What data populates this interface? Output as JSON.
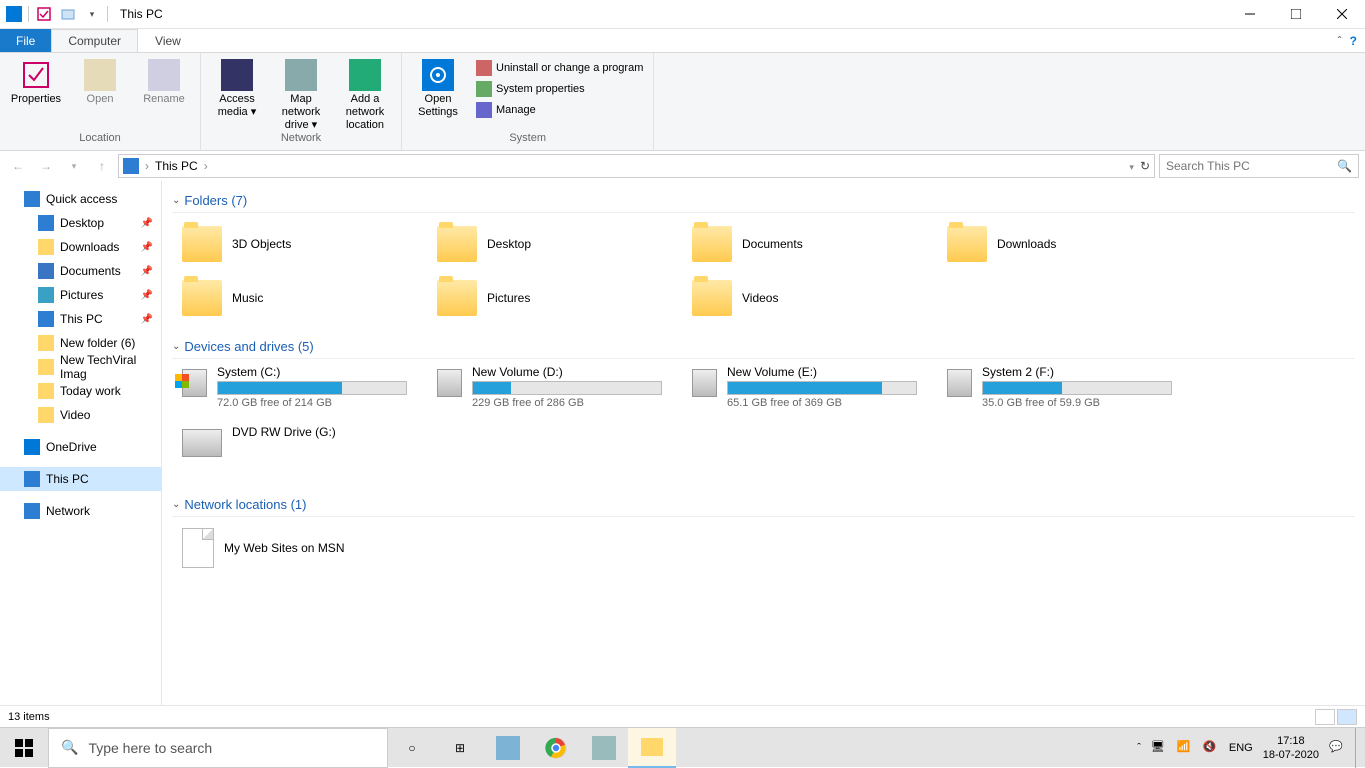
{
  "title": "This PC",
  "ribbon_tabs": {
    "file": "File",
    "computer": "Computer",
    "view": "View"
  },
  "ribbon": {
    "location": {
      "properties": "Properties",
      "open": "Open",
      "rename": "Rename",
      "label": "Location"
    },
    "network": {
      "access_media": "Access media",
      "map_drive": "Map network drive",
      "add_location": "Add a network location",
      "label": "Network"
    },
    "system": {
      "open_settings": "Open Settings",
      "uninstall": "Uninstall or change a program",
      "properties": "System properties",
      "manage": "Manage",
      "label": "System"
    }
  },
  "address": {
    "location": "This PC"
  },
  "search": {
    "placeholder": "Search This PC"
  },
  "sidebar": {
    "quick_access": "Quick access",
    "desktop": "Desktop",
    "downloads": "Downloads",
    "documents": "Documents",
    "pictures": "Pictures",
    "this_pc": "This PC",
    "new_folder": "New folder (6)",
    "new_techviral": "New TechViral Imag",
    "today_work": "Today work",
    "video": "Video",
    "onedrive": "OneDrive",
    "this_pc2": "This PC",
    "network": "Network"
  },
  "sections": {
    "folders": "Folders (7)",
    "drives": "Devices and drives (5)",
    "netloc": "Network locations (1)"
  },
  "folders": [
    {
      "name": "3D Objects"
    },
    {
      "name": "Desktop"
    },
    {
      "name": "Documents"
    },
    {
      "name": "Downloads"
    },
    {
      "name": "Music"
    },
    {
      "name": "Pictures"
    },
    {
      "name": "Videos"
    }
  ],
  "drives": [
    {
      "name": "System (C:)",
      "free": "72.0 GB free of 214 GB",
      "fill": 66,
      "windows": true
    },
    {
      "name": "New Volume (D:)",
      "free": "229 GB free of 286 GB",
      "fill": 20
    },
    {
      "name": "New Volume (E:)",
      "free": "65.1 GB free of 369 GB",
      "fill": 82
    },
    {
      "name": "System 2 (F:)",
      "free": "35.0 GB free of 59.9 GB",
      "fill": 42
    },
    {
      "name": "DVD RW Drive (G:)",
      "nodisc": true
    }
  ],
  "netloc": [
    {
      "name": "My Web Sites on MSN"
    }
  ],
  "status": {
    "items": "13 items"
  },
  "taskbar": {
    "search_placeholder": "Type here to search",
    "lang": "ENG",
    "time": "17:18",
    "date": "18-07-2020"
  }
}
